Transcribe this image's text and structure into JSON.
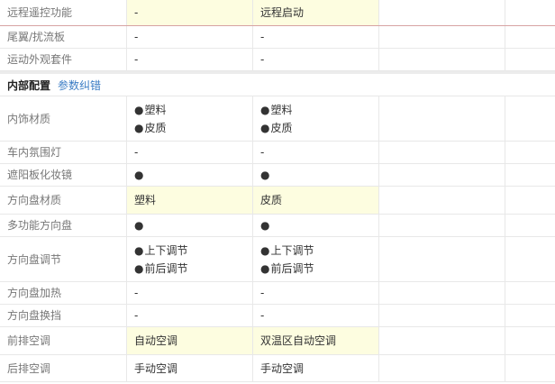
{
  "rows_top": [
    {
      "label": "远程遥控功能",
      "v1": "-",
      "v2": "远程启动",
      "hl": true,
      "red": true,
      "h": 29
    },
    {
      "label": "尾翼/扰流板",
      "v1": "-",
      "v2": "-",
      "hl": false,
      "h": 25
    },
    {
      "label": "运动外观套件",
      "v1": "-",
      "v2": "-",
      "hl": false,
      "h": 25
    }
  ],
  "section": {
    "title": "内部配置",
    "link": "参数纠错"
  },
  "bullet": "●",
  "rows_bottom": [
    {
      "label": "内饰材质",
      "v1": [
        "塑料",
        "皮质"
      ],
      "v2": [
        "塑料",
        "皮质"
      ],
      "hl": false,
      "h": 50
    },
    {
      "label": "车内氛围灯",
      "v1": "-",
      "v2": "-",
      "hl": false,
      "h": 25
    },
    {
      "label": "遮阳板化妆镜",
      "v1": "●",
      "v2": "●",
      "hl": false,
      "h": 25
    },
    {
      "label": "方向盘材质",
      "v1": "塑料",
      "v2": "皮质",
      "hl": true,
      "h": 31
    },
    {
      "label": "多功能方向盘",
      "v1": "●",
      "v2": "●",
      "hl": false,
      "h": 25
    },
    {
      "label": "方向盘调节",
      "v1": [
        "上下调节",
        "前后调节"
      ],
      "v2": [
        "上下调节",
        "前后调节"
      ],
      "hl": false,
      "h": 50
    },
    {
      "label": "方向盘加热",
      "v1": "-",
      "v2": "-",
      "hl": false,
      "h": 25
    },
    {
      "label": "方向盘换挡",
      "v1": "-",
      "v2": "-",
      "hl": false,
      "h": 25
    },
    {
      "label": "前排空调",
      "v1": "自动空调",
      "v2": "双温区自动空调",
      "hl": true,
      "h": 31
    },
    {
      "label": "后排空调",
      "v1": "手动空调",
      "v2": "手动空调",
      "hl": false,
      "h": 30
    }
  ]
}
